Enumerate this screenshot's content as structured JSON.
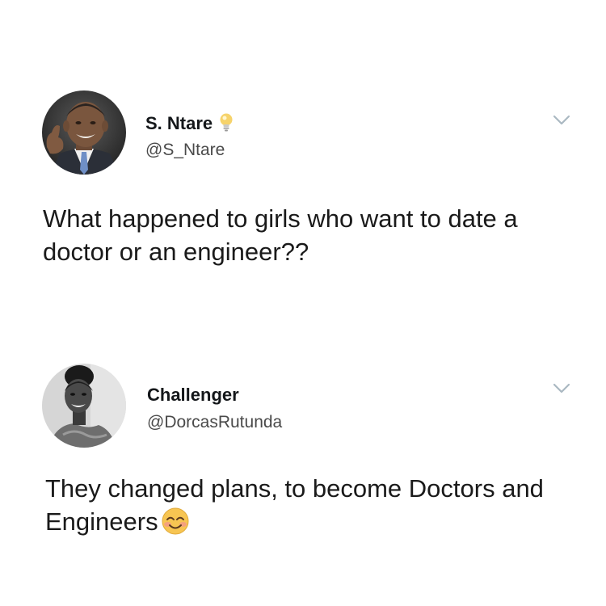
{
  "tweets": [
    {
      "display_name": "S. Ntare",
      "handle": "@S_Ntare",
      "text": "What happened to girls who want to date a doctor or an engineer??",
      "name_badge_icon": "lightbulb-icon",
      "menu_icon": "chevron-down-icon"
    },
    {
      "display_name": "Challenger",
      "handle": "@DorcasRutunda",
      "text": "They changed plans, to become Doctors and Engineers",
      "trailing_emoji": "smiling-face-with-smiling-eyes-icon",
      "menu_icon": "chevron-down-icon"
    }
  ],
  "colors": {
    "text": "#14171a",
    "handle": "#4a4a4a",
    "chevron": "#aab8c2",
    "background": "#ffffff"
  }
}
